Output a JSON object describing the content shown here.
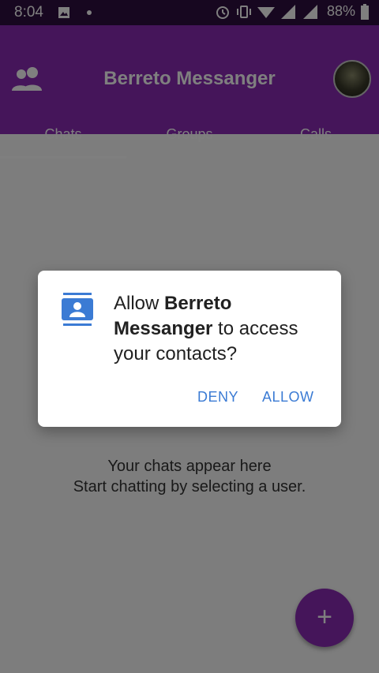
{
  "status_bar": {
    "time": "8:04",
    "battery": "88%",
    "icons": [
      "image-icon",
      "dot-icon",
      "alarm-icon",
      "vibrate-icon",
      "wifi-icon",
      "signal-icon",
      "signal-icon",
      "battery-icon"
    ]
  },
  "app_bar": {
    "title": "Berreto Messanger",
    "tabs": [
      {
        "label": "Chats"
      },
      {
        "label": "Groups"
      },
      {
        "label": "Calls"
      }
    ],
    "selected_tab": "Chats"
  },
  "empty_state": {
    "line1": "Your chats appear here",
    "line2": "Start chatting by selecting a user."
  },
  "fab": {
    "label": "+"
  },
  "dialog": {
    "prefix": "Allow ",
    "app_name": "Berreto Messanger",
    "suffix": " to access your contacts?",
    "deny_label": "DENY",
    "allow_label": "ALLOW"
  },
  "colors": {
    "primary": "#8a2ab5",
    "status_bar": "#2e0e40",
    "dialog_button": "#3b7bd4"
  }
}
